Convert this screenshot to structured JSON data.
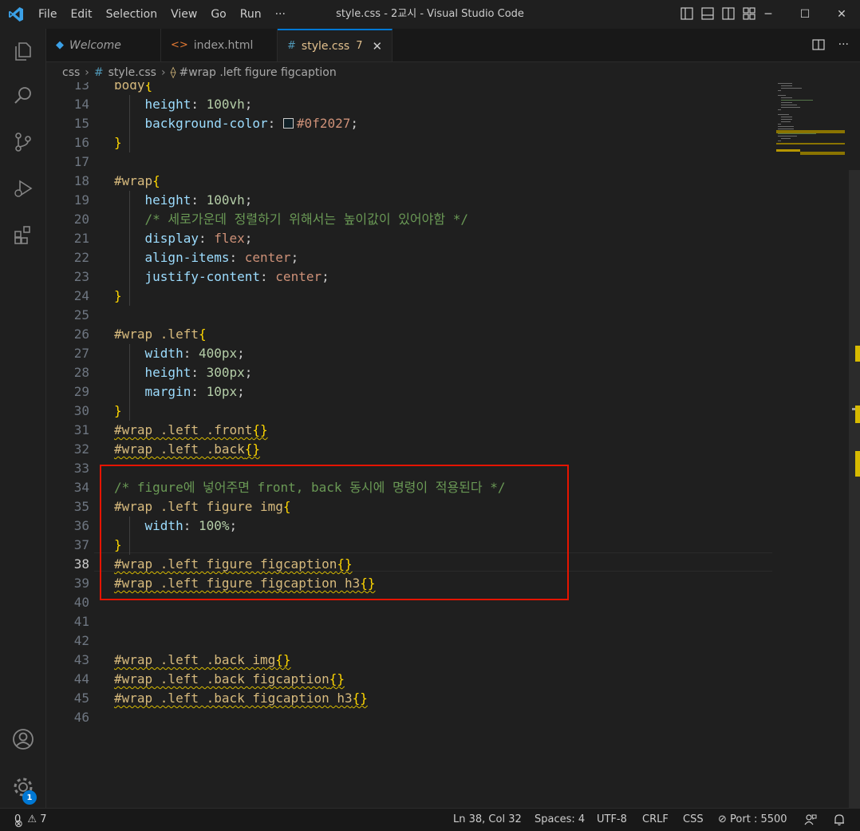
{
  "window": {
    "title": "style.css - 2교시 - Visual Studio Code",
    "menu": [
      "File",
      "Edit",
      "Selection",
      "View",
      "Go",
      "Run",
      "···"
    ],
    "controls": [
      "─",
      "☐",
      "✕"
    ]
  },
  "tabs": [
    {
      "label": "Welcome",
      "icon": "vscode-icon"
    },
    {
      "label": "index.html",
      "icon": "html-icon"
    },
    {
      "label": "style.css",
      "icon": "css-icon",
      "count": "7",
      "close": "✕",
      "active": true
    }
  ],
  "breadcrumb": {
    "folder": "css",
    "file": "style.css",
    "symbol": "#wrap .left figure figcaption"
  },
  "editor": {
    "current_line": 38,
    "lines": [
      {
        "n": "13",
        "text": "body{"
      },
      {
        "n": "14",
        "text": "    height: 100vh;"
      },
      {
        "n": "15",
        "text": "    background-color: #0f2027;"
      },
      {
        "n": "16",
        "text": "}"
      },
      {
        "n": "17",
        "text": ""
      },
      {
        "n": "18",
        "text": "#wrap{"
      },
      {
        "n": "19",
        "text": "    height: 100vh;"
      },
      {
        "n": "20",
        "text": "    /* 세로가운데 정렬하기 위해서는 높이값이 있어야함 */"
      },
      {
        "n": "21",
        "text": "    display: flex;"
      },
      {
        "n": "22",
        "text": "    align-items: center;"
      },
      {
        "n": "23",
        "text": "    justify-content: center;"
      },
      {
        "n": "24",
        "text": "}"
      },
      {
        "n": "25",
        "text": ""
      },
      {
        "n": "26",
        "text": "#wrap .left{"
      },
      {
        "n": "27",
        "text": "    width: 400px;"
      },
      {
        "n": "28",
        "text": "    height: 300px;"
      },
      {
        "n": "29",
        "text": "    margin: 10px;"
      },
      {
        "n": "30",
        "text": "}"
      },
      {
        "n": "31",
        "text": "#wrap .left .front{}"
      },
      {
        "n": "32",
        "text": "#wrap .left .back{}"
      },
      {
        "n": "33",
        "text": ""
      },
      {
        "n": "34",
        "text": "/* figure에 넣어주면 front, back 동시에 명령이 적용된다 */"
      },
      {
        "n": "35",
        "text": "#wrap .left figure img{"
      },
      {
        "n": "36",
        "text": "    width: 100%;"
      },
      {
        "n": "37",
        "text": "}"
      },
      {
        "n": "38",
        "text": "#wrap .left figure figcaption{}"
      },
      {
        "n": "39",
        "text": "#wrap .left figure figcaption h3{}"
      },
      {
        "n": "40",
        "text": ""
      },
      {
        "n": "41",
        "text": ""
      },
      {
        "n": "42",
        "text": ""
      },
      {
        "n": "43",
        "text": "#wrap .left .back img{}"
      },
      {
        "n": "44",
        "text": "#wrap .left .back figcaption{}"
      },
      {
        "n": "45",
        "text": "#wrap .left .back figcaption h3{}"
      },
      {
        "n": "46",
        "text": ""
      }
    ]
  },
  "activity": {
    "settings_badge": "1"
  },
  "status": {
    "errors": "0",
    "warnings": "7",
    "position": "Ln 38, Col 32",
    "spaces": "Spaces: 4",
    "encoding": "UTF-8",
    "eol": "CRLF",
    "language": "CSS",
    "port": "Port : 5500"
  },
  "colors": {
    "accent": "#0078d4",
    "highlight_box": "#e51400",
    "warning": "#d7ba00"
  }
}
